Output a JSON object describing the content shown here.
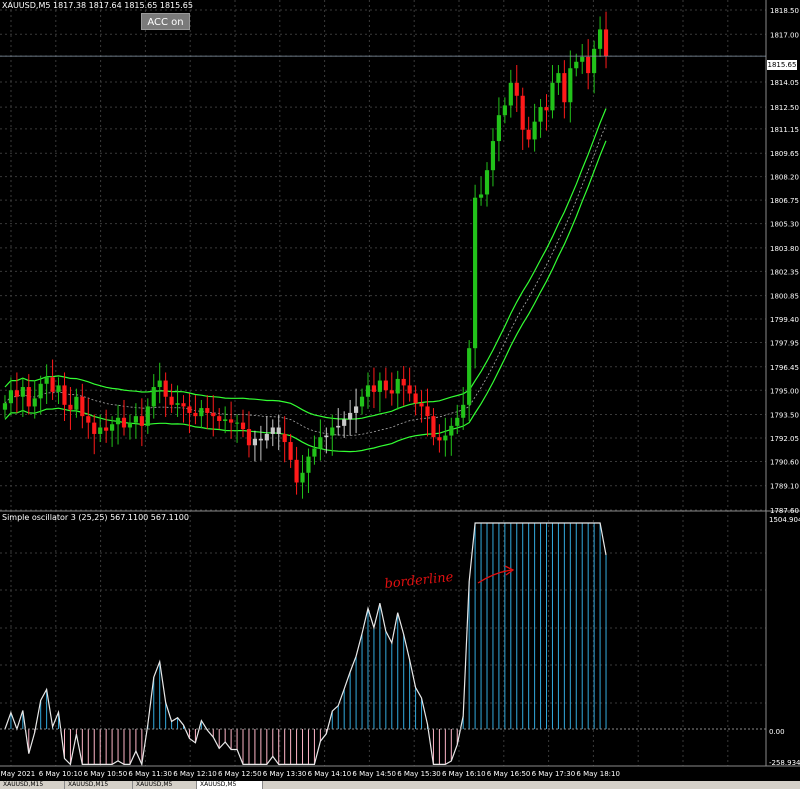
{
  "window": {
    "symbol_info": "XAUUSD,M5  1817.38 1817.64 1815.65 1815.65",
    "acc_button": "ACC on"
  },
  "price_axis": {
    "labels": [
      "1818.50",
      "1817.00",
      "1815.65",
      "1814.05",
      "1812.50",
      "1811.15",
      "1809.65",
      "1808.20",
      "1806.75",
      "1805.30",
      "1803.80",
      "1802.35",
      "1800.85",
      "1799.40",
      "1797.95",
      "1796.45",
      "1795.00",
      "1793.50",
      "1792.05",
      "1790.60",
      "1789.10",
      "1787.60"
    ],
    "current": "1815.65"
  },
  "oscillator": {
    "title": "Simple oscillator 3 (25,25) 567.1100 567.1100",
    "axis_labels": [
      "1504.9045",
      "0.00",
      "-258.9345"
    ],
    "annotation": "borderline"
  },
  "time_axis": {
    "labels": [
      "6 May 2021",
      "6 May 10:10",
      "6 May 10:50",
      "6 May 11:30",
      "6 May 12:10",
      "6 May 12:50",
      "6 May 13:30",
      "6 May 14:10",
      "6 May 14:50",
      "6 May 15:30",
      "6 May 16:10",
      "6 May 16:50",
      "6 May 17:30",
      "6 May 18:10"
    ]
  },
  "tabs": [
    "XAUUSD,M15",
    "XAUUSD,M15",
    "XAUUSD,M5",
    "XAUUSD,M5"
  ],
  "colors": {
    "bull": "#22c21a",
    "bear": "#ff1a1a",
    "neutral": "#c8c8c8",
    "band": "#33ff33",
    "histo_pos": "#33aadd",
    "histo_neg": "#ffb6c8",
    "grid": "#3a3a3a",
    "annotation": "#e01010"
  },
  "chart_data": {
    "type": "candlestick",
    "price_range": [
      1787.6,
      1818.5
    ],
    "closes": [
      1794.2,
      1795.0,
      1794.6,
      1795.2,
      1794.0,
      1794.5,
      1795.4,
      1795.8,
      1794.9,
      1795.3,
      1794.1,
      1793.8,
      1794.6,
      1793.4,
      1793.0,
      1792.3,
      1792.7,
      1792.5,
      1792.9,
      1793.3,
      1792.7,
      1793.0,
      1793.4,
      1792.8,
      1794.0,
      1795.2,
      1795.6,
      1794.6,
      1794.1,
      1794.2,
      1794.0,
      1793.6,
      1793.4,
      1793.9,
      1793.6,
      1793.4,
      1793.1,
      1793.2,
      1793.0,
      1793.0,
      1792.6,
      1791.6,
      1792.0,
      1791.9,
      1792.3,
      1792.7,
      1792.3,
      1791.8,
      1790.7,
      1789.3,
      1789.9,
      1790.9,
      1791.4,
      1792.1,
      1792.2,
      1792.7,
      1792.8,
      1793.2,
      1793.6,
      1794.0,
      1794.6,
      1795.3,
      1794.9,
      1795.6,
      1795.0,
      1794.8,
      1795.7,
      1795.3,
      1794.8,
      1794.2,
      1794.0,
      1793.4,
      1792.1,
      1791.9,
      1792.2,
      1792.8,
      1793.3,
      1794.1,
      1797.6,
      1806.9,
      1807.1,
      1808.6,
      1810.4,
      1812.0,
      1812.6,
      1814.0,
      1813.2,
      1811.1,
      1810.5,
      1811.6,
      1812.5,
      1812.3,
      1814.0,
      1814.6,
      1812.8,
      1814.9,
      1815.3,
      1815.6,
      1814.6,
      1816.1,
      1817.3,
      1815.65
    ]
  }
}
